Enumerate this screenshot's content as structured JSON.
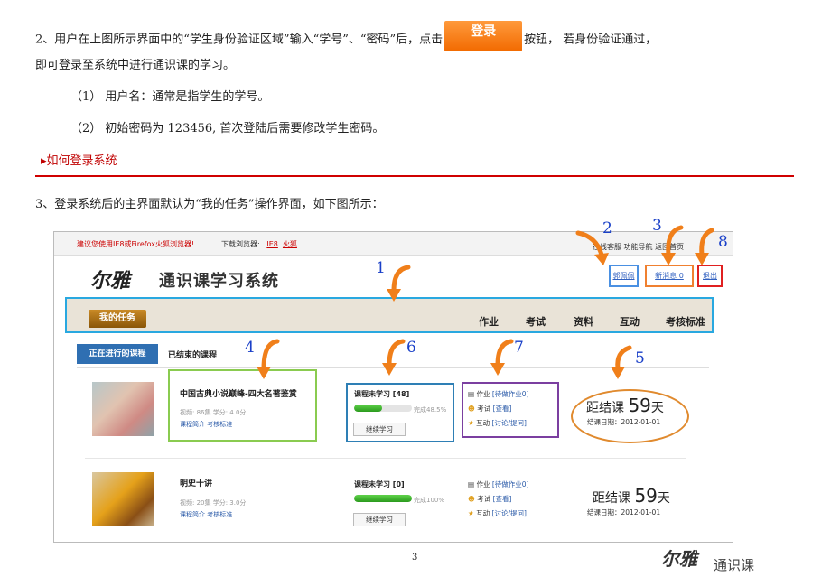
{
  "doc": {
    "p1_before": "2、用户在上图所示界面中的“学生身份验证区域”输入“学号”、“密码”后，点击",
    "login_btn": "登录",
    "p1_after": "按钮， 若身份验证通过，",
    "p2": "即可登录至系统中进行通识课的学习。",
    "li1": "（1）   用户名：通常是指学生的学号。",
    "li2": "（2）   初始密码为 123456, 首次登陆后需要修改学生密码。",
    "link": "▸如何登录系统",
    "p3": "3、登录系统后的主界面默认为“我的任务”操作界面，如下图所示：",
    "page_number": "3",
    "brand_logo": "尔雅",
    "brand_text": "通识课",
    "colors": {
      "accent_red": "#d00000",
      "annotation_blue": "#1a40c8",
      "arrow_orange": "#f07f1a"
    }
  },
  "screenshot": {
    "warning": "建议您使用IE8或Firefox火狐浏览器!",
    "download_label": "下载浏览器:",
    "browser_ie": "IE8",
    "browser_ff": "火狐",
    "top_links": "在线客服  功能导航  返回首页",
    "logo": "尔雅",
    "system_name": "通识课学习系统",
    "user_link": "郭佩佩",
    "message_link": "新消息 0",
    "exit_link": "退出",
    "my_task": "我的任务",
    "nav": [
      "作业",
      "考试",
      "资料",
      "互动",
      "考核标准"
    ],
    "tab_active": "正在进行的课程",
    "tab_inactive": "已结束的课程",
    "courses": [
      {
        "name": "中国古典小说巅峰-四大名著鉴赏",
        "meta": "视频: 86集  学分: 4.0分",
        "links": "课程简介  考核标准",
        "progress_title": "课程未学习 [48]",
        "progress": 0.485,
        "progress_text": "完成48.5%",
        "continue": "继续学习",
        "hw": "作业",
        "hw_link": "[待做作业0]",
        "exam": "考试",
        "exam_link": "[查看]",
        "inter": "互动",
        "inter_link": "[讨论/提问]",
        "countdown_label": "距结课",
        "countdown_num": "59",
        "countdown_unit": "天",
        "end_date": "结课日期：2012-01-01"
      },
      {
        "name": "明史十讲",
        "meta": "视频: 20集  学分: 3.0分",
        "links": "课程简介  考核标准",
        "progress_title": "课程未学习 [0]",
        "progress": 1.0,
        "progress_text": "完成100%",
        "continue": "继续学习",
        "hw": "作业",
        "hw_link": "[待做作业0]",
        "exam": "考试",
        "exam_link": "[查看]",
        "inter": "互动",
        "inter_link": "[讨论/提问]",
        "countdown_label": "距结课",
        "countdown_num": "59",
        "countdown_unit": "天",
        "end_date": "结课日期：2012-01-01"
      }
    ],
    "annotations": [
      "1",
      "2",
      "3",
      "4",
      "5",
      "6",
      "7",
      "8"
    ]
  }
}
